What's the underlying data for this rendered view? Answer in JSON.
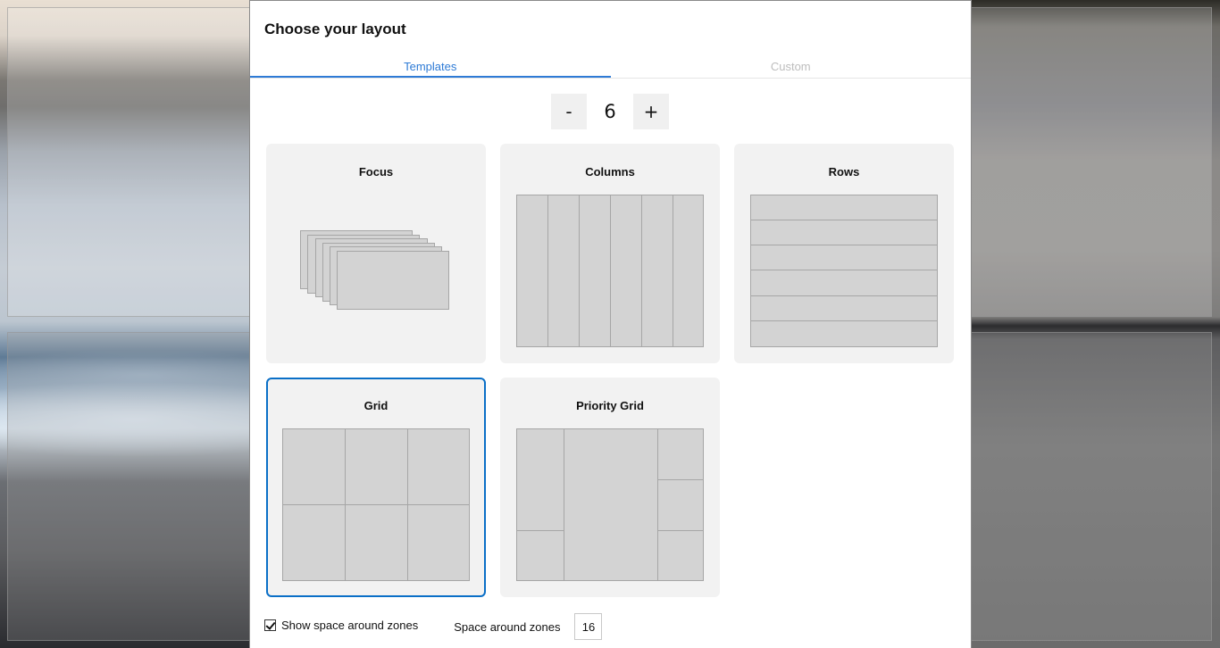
{
  "dialog": {
    "title": "Choose your layout"
  },
  "tabs": [
    {
      "label": "Templates",
      "active": true
    },
    {
      "label": "Custom",
      "active": false
    }
  ],
  "zone_count": {
    "decrement_label": "-",
    "value": "6",
    "increment_label": "+"
  },
  "templates": [
    {
      "name": "Focus",
      "selected": false
    },
    {
      "name": "Columns",
      "selected": false
    },
    {
      "name": "Rows",
      "selected": false
    },
    {
      "name": "Grid",
      "selected": true
    },
    {
      "name": "Priority Grid",
      "selected": false
    }
  ],
  "footer": {
    "show_space_label": "Show space around zones",
    "show_space_checked": true,
    "space_label": "Space around zones",
    "space_value": "16"
  },
  "colors": {
    "accent": "#2e7bd6",
    "selected_border": "#0a6fc7",
    "card_bg": "#f2f2f2",
    "zone_fill": "#d3d3d3",
    "zone_border": "#a6a6a6"
  }
}
